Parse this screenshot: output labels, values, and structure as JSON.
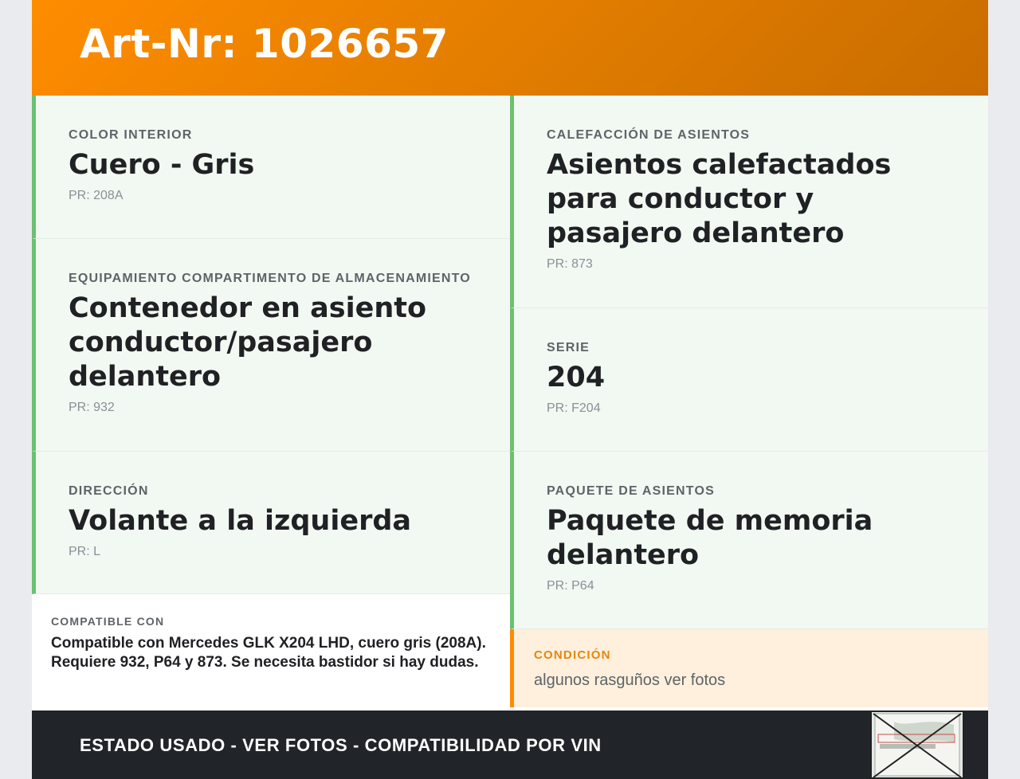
{
  "header": {
    "title": "Art-Nr: 1026657"
  },
  "left": [
    {
      "label": "COLOR INTERIOR",
      "value": "Cuero - Gris",
      "pr": "PR: 208A"
    },
    {
      "label": "EQUIPAMIENTO COMPARTIMENTO DE ALMACENAMIENTO",
      "value": "Contenedor en asiento conductor/pasajero delantero",
      "pr": "PR: 932"
    },
    {
      "label": "DIRECCIÓN",
      "value": "Volante a la izquierda",
      "pr": "PR: L"
    }
  ],
  "right": [
    {
      "label": "CALEFACCIÓN DE ASIENTOS",
      "value": "Asientos calefactados para conductor y pasajero delantero",
      "pr": "PR: 873"
    },
    {
      "label": "SERIE",
      "value": "204",
      "pr": "PR: F204"
    },
    {
      "label": "PAQUETE DE ASIENTOS",
      "value": "Paquete de memoria delantero",
      "pr": "PR: P64"
    }
  ],
  "compat": {
    "label": "COMPATIBLE CON",
    "text": "Compatible con Mercedes GLK X204 LHD, cuero gris (208A). Requiere 932, P64 y 873. Se necesita bastidor si hay dudas."
  },
  "condition": {
    "label": "CONDICIÓN",
    "text": "algunos rasguños ver fotos"
  },
  "footer": {
    "text": "ESTADO USADO - VER FOTOS - COMPATIBILIDAD POR VIN"
  },
  "colors": {
    "header_start": "#ff8c00",
    "header_end": "#c96d00",
    "accent_green": "#6cc070",
    "accent_orange": "#ff8c00",
    "footer_bg": "#212529"
  }
}
